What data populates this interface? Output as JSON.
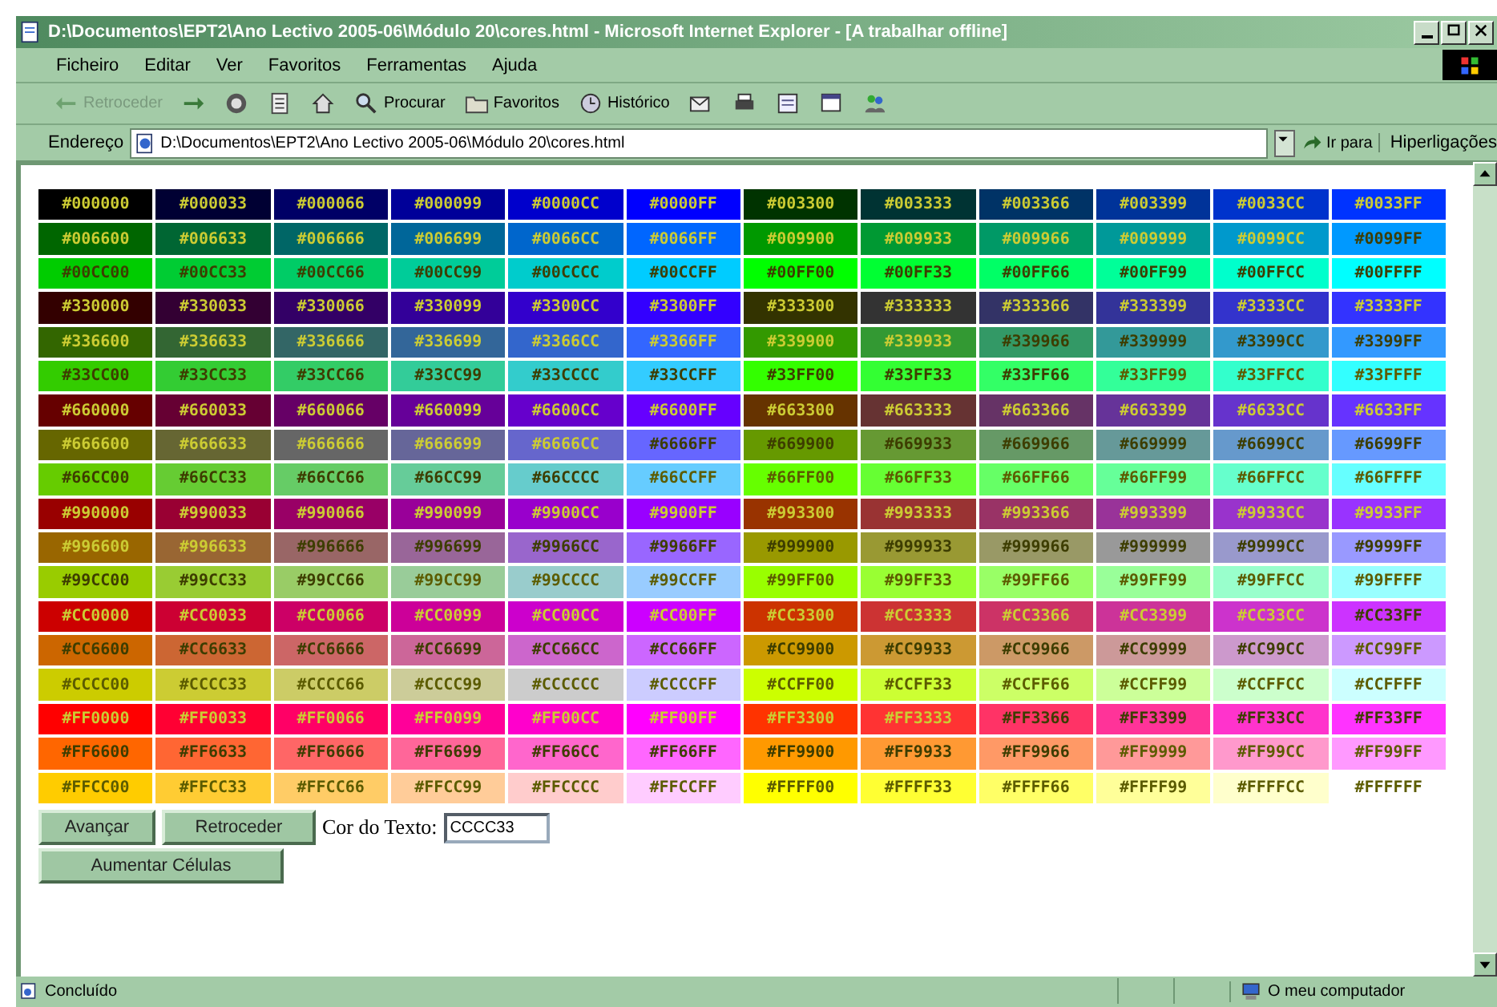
{
  "window": {
    "title": "D:\\Documentos\\EPT2\\Ano Lectivo 2005-06\\Módulo 20\\cores.html - Microsoft Internet Explorer - [A trabalhar offline]"
  },
  "menu": [
    "Ficheiro",
    "Editar",
    "Ver",
    "Favoritos",
    "Ferramentas",
    "Ajuda"
  ],
  "toolbar": [
    {
      "kind": "back",
      "label": "Retroceder",
      "disabled": true
    },
    {
      "kind": "forward"
    },
    {
      "kind": "stop"
    },
    {
      "kind": "refresh"
    },
    {
      "kind": "home"
    },
    {
      "kind": "search",
      "label": "Procurar"
    },
    {
      "kind": "favorites",
      "label": "Favoritos"
    },
    {
      "kind": "history",
      "label": "Histórico"
    },
    {
      "kind": "mail"
    },
    {
      "kind": "print"
    },
    {
      "kind": "edit"
    },
    {
      "kind": "discuss"
    },
    {
      "kind": "messenger"
    }
  ],
  "address": {
    "label": "Endereço",
    "value": "D:\\Documentos\\EPT2\\Ano Lectivo 2005-06\\Módulo 20\\cores.html",
    "go": "Ir para",
    "links": "Hiperligações"
  },
  "table": {
    "rows": [
      [
        {
          "text": "#000000",
          "color": "#000000"
        },
        {
          "text": "#000033",
          "color": "#000033"
        },
        {
          "text": "#000066",
          "color": "#000066"
        },
        {
          "text": "#000099",
          "color": "#000099"
        },
        {
          "text": "#0000CC",
          "color": "#0000cc"
        },
        {
          "text": "#0000FF",
          "color": "#0000ff"
        },
        {
          "text": "#003300",
          "color": "#003300"
        },
        {
          "text": "#003333",
          "color": "#003333"
        },
        {
          "text": "#003366",
          "color": "#003366"
        },
        {
          "text": "#003399",
          "color": "#003399"
        },
        {
          "text": "#0033CC",
          "color": "#0033cc"
        },
        {
          "text": "#0033FF",
          "color": "#0033ff"
        }
      ],
      [
        {
          "text": "#006600",
          "color": "#006600"
        },
        {
          "text": "#006633",
          "color": "#006633"
        },
        {
          "text": "#006666",
          "color": "#006666"
        },
        {
          "text": "#006699",
          "color": "#006699"
        },
        {
          "text": "#0066CC",
          "color": "#0066cc"
        },
        {
          "text": "#0066FF",
          "color": "#0066ff"
        },
        {
          "text": "#009900",
          "color": "#009900"
        },
        {
          "text": "#009933",
          "color": "#009933"
        },
        {
          "text": "#009966",
          "color": "#009966"
        },
        {
          "text": "#009999",
          "color": "#009999"
        },
        {
          "text": "#0099CC",
          "color": "#0099cc"
        },
        {
          "text": "#0099FF",
          "color": "#0099ff"
        }
      ],
      [
        {
          "text": "#00CC00",
          "color": "#00cc00"
        },
        {
          "text": "#00CC33",
          "color": "#00cc33"
        },
        {
          "text": "#00CC66",
          "color": "#00cc66"
        },
        {
          "text": "#00CC99",
          "color": "#00cc99"
        },
        {
          "text": "#00CCCC",
          "color": "#00cccc"
        },
        {
          "text": "#00CCFF",
          "color": "#00ccff"
        },
        {
          "text": "#00FF00",
          "color": "#00ff00"
        },
        {
          "text": "#00FF33",
          "color": "#00ff33"
        },
        {
          "text": "#00FF66",
          "color": "#00ff66"
        },
        {
          "text": "#00FF99",
          "color": "#00ff99"
        },
        {
          "text": "#00FFCC",
          "color": "#00ffcc"
        },
        {
          "text": "#00FFFF",
          "color": "#00ffff"
        }
      ],
      [
        {
          "text": "#330000",
          "color": "#330000"
        },
        {
          "text": "#330033",
          "color": "#330033"
        },
        {
          "text": "#330066",
          "color": "#330066"
        },
        {
          "text": "#330099",
          "color": "#330099"
        },
        {
          "text": "#3300CC",
          "color": "#3300cc"
        },
        {
          "text": "#3300FF",
          "color": "#3300ff"
        },
        {
          "text": "#333300",
          "color": "#333300"
        },
        {
          "text": "#333333",
          "color": "#333333"
        },
        {
          "text": "#333366",
          "color": "#333366"
        },
        {
          "text": "#333399",
          "color": "#333399"
        },
        {
          "text": "#3333CC",
          "color": "#3333cc"
        },
        {
          "text": "#3333FF",
          "color": "#3333ff"
        }
      ],
      [
        {
          "text": "#336600",
          "color": "#336600"
        },
        {
          "text": "#336633",
          "color": "#336633"
        },
        {
          "text": "#336666",
          "color": "#336666"
        },
        {
          "text": "#336699",
          "color": "#336699"
        },
        {
          "text": "#3366CC",
          "color": "#3366cc"
        },
        {
          "text": "#3366FF",
          "color": "#3366ff"
        },
        {
          "text": "#339900",
          "color": "#339900"
        },
        {
          "text": "#339933",
          "color": "#339933"
        },
        {
          "text": "#339966",
          "color": "#339966"
        },
        {
          "text": "#339999",
          "color": "#339999"
        },
        {
          "text": "#3399CC",
          "color": "#3399cc"
        },
        {
          "text": "#3399FF",
          "color": "#3399ff"
        }
      ],
      [
        {
          "text": "#33CC00",
          "color": "#33cc00"
        },
        {
          "text": "#33CC33",
          "color": "#33cc33"
        },
        {
          "text": "#33CC66",
          "color": "#33cc66"
        },
        {
          "text": "#33CC99",
          "color": "#33cc99"
        },
        {
          "text": "#33CCCC",
          "color": "#33cccc"
        },
        {
          "text": "#33CCFF",
          "color": "#33ccff"
        },
        {
          "text": "#33FF00",
          "color": "#33ff00"
        },
        {
          "text": "#33FF33",
          "color": "#33ff33"
        },
        {
          "text": "#33FF66",
          "color": "#33ff66"
        },
        {
          "text": "#33FF99",
          "color": "#33ff99"
        },
        {
          "text": "#33FFCC",
          "color": "#33ffcc"
        },
        {
          "text": "#33FFFF",
          "color": "#33ffff"
        }
      ],
      [
        {
          "text": "#660000",
          "color": "#660000"
        },
        {
          "text": "#660033",
          "color": "#660033"
        },
        {
          "text": "#660066",
          "color": "#660066"
        },
        {
          "text": "#660099",
          "color": "#660099"
        },
        {
          "text": "#6600CC",
          "color": "#6600cc"
        },
        {
          "text": "#6600FF",
          "color": "#6600ff"
        },
        {
          "text": "#663300",
          "color": "#663300"
        },
        {
          "text": "#663333",
          "color": "#663333"
        },
        {
          "text": "#663366",
          "color": "#663366"
        },
        {
          "text": "#663399",
          "color": "#663399"
        },
        {
          "text": "#6633CC",
          "color": "#6633cc"
        },
        {
          "text": "#6633FF",
          "color": "#6633ff"
        }
      ],
      [
        {
          "text": "#666600",
          "color": "#666600"
        },
        {
          "text": "#666633",
          "color": "#666633"
        },
        {
          "text": "#666666",
          "color": "#666666"
        },
        {
          "text": "#666699",
          "color": "#666699"
        },
        {
          "text": "#6666CC",
          "color": "#6666cc"
        },
        {
          "text": "#6666FF",
          "color": "#6666ff"
        },
        {
          "text": "#669900",
          "color": "#669900"
        },
        {
          "text": "#669933",
          "color": "#669933"
        },
        {
          "text": "#669966",
          "color": "#669966"
        },
        {
          "text": "#669999",
          "color": "#669999"
        },
        {
          "text": "#6699CC",
          "color": "#6699cc"
        },
        {
          "text": "#6699FF",
          "color": "#6699ff"
        }
      ],
      [
        {
          "text": "#66CC00",
          "color": "#66cc00"
        },
        {
          "text": "#66CC33",
          "color": "#66cc33"
        },
        {
          "text": "#66CC66",
          "color": "#66cc66"
        },
        {
          "text": "#66CC99",
          "color": "#66cc99"
        },
        {
          "text": "#66CCCC",
          "color": "#66cccc"
        },
        {
          "text": "#66CCFF",
          "color": "#66ccff"
        },
        {
          "text": "#66FF00",
          "color": "#66ff00"
        },
        {
          "text": "#66FF33",
          "color": "#66ff33"
        },
        {
          "text": "#66FF66",
          "color": "#66ff66"
        },
        {
          "text": "#66FF99",
          "color": "#66ff99"
        },
        {
          "text": "#66FFCC",
          "color": "#66ffcc"
        },
        {
          "text": "#66FFFF",
          "color": "#66ffff"
        }
      ],
      [
        {
          "text": "#990000",
          "color": "#990000"
        },
        {
          "text": "#990033",
          "color": "#990033"
        },
        {
          "text": "#990066",
          "color": "#990066"
        },
        {
          "text": "#990099",
          "color": "#990099"
        },
        {
          "text": "#9900CC",
          "color": "#9900cc"
        },
        {
          "text": "#9900FF",
          "color": "#9900ff"
        },
        {
          "text": "#993300",
          "color": "#993300"
        },
        {
          "text": "#993333",
          "color": "#993333"
        },
        {
          "text": "#993366",
          "color": "#993366"
        },
        {
          "text": "#993399",
          "color": "#993399"
        },
        {
          "text": "#9933CC",
          "color": "#9933cc"
        },
        {
          "text": "#9933FF",
          "color": "#9933ff"
        }
      ],
      [
        {
          "text": "#996600",
          "color": "#996600"
        },
        {
          "text": "#996633",
          "color": "#996633"
        },
        {
          "text": "#996666",
          "color": "#996666"
        },
        {
          "text": "#996699",
          "color": "#996699"
        },
        {
          "text": "#9966CC",
          "color": "#9966cc"
        },
        {
          "text": "#9966FF",
          "color": "#9966ff"
        },
        {
          "text": "#999900",
          "color": "#999900"
        },
        {
          "text": "#999933",
          "color": "#999933"
        },
        {
          "text": "#999966",
          "color": "#999966"
        },
        {
          "text": "#999999",
          "color": "#999999"
        },
        {
          "text": "#9999CC",
          "color": "#9999cc"
        },
        {
          "text": "#9999FF",
          "color": "#9999ff"
        }
      ],
      [
        {
          "text": "#99CC00",
          "color": "#99cc00"
        },
        {
          "text": "#99CC33",
          "color": "#99cc33"
        },
        {
          "text": "#99CC66",
          "color": "#99cc66"
        },
        {
          "text": "#99CC99",
          "color": "#99cc99"
        },
        {
          "text": "#99CCCC",
          "color": "#99cccc"
        },
        {
          "text": "#99CCFF",
          "color": "#99ccff"
        },
        {
          "text": "#99FF00",
          "color": "#99ff00"
        },
        {
          "text": "#99FF33",
          "color": "#99ff33"
        },
        {
          "text": "#99FF66",
          "color": "#99ff66"
        },
        {
          "text": "#99FF99",
          "color": "#99ff99"
        },
        {
          "text": "#99FFCC",
          "color": "#99ffcc"
        },
        {
          "text": "#99FFFF",
          "color": "#99ffff"
        }
      ],
      [
        {
          "text": "#CC0000",
          "color": "#cc0000"
        },
        {
          "text": "#CC0033",
          "color": "#cc0033"
        },
        {
          "text": "#CC0066",
          "color": "#cc0066"
        },
        {
          "text": "#CC0099",
          "color": "#cc0099"
        },
        {
          "text": "#CC00CC",
          "color": "#cc00cc"
        },
        {
          "text": "#CC00FF",
          "color": "#cc00ff"
        },
        {
          "text": "#CC3300",
          "color": "#cc3300"
        },
        {
          "text": "#CC3333",
          "color": "#cc3333"
        },
        {
          "text": "#CC3366",
          "color": "#cc3366"
        },
        {
          "text": "#CC3399",
          "color": "#cc3399"
        },
        {
          "text": "#CC33CC",
          "color": "#cc33cc"
        },
        {
          "text": "#CC33FF",
          "color": "#cc33ff"
        }
      ],
      [
        {
          "text": "#CC6600",
          "color": "#cc6600"
        },
        {
          "text": "#CC6633",
          "color": "#cc6633"
        },
        {
          "text": "#CC6666",
          "color": "#cc6666"
        },
        {
          "text": "#CC6699",
          "color": "#cc6699"
        },
        {
          "text": "#CC66CC",
          "color": "#cc66cc"
        },
        {
          "text": "#CC66FF",
          "color": "#cc66ff"
        },
        {
          "text": "#CC9900",
          "color": "#cc9900"
        },
        {
          "text": "#CC9933",
          "color": "#cc9933"
        },
        {
          "text": "#CC9966",
          "color": "#cc9966"
        },
        {
          "text": "#CC9999",
          "color": "#cc9999"
        },
        {
          "text": "#CC99CC",
          "color": "#cc99cc"
        },
        {
          "text": "#CC99FF",
          "color": "#cc99ff"
        }
      ],
      [
        {
          "text": "#CCCC00",
          "color": "#cccc00"
        },
        {
          "text": "#CCCC33",
          "color": "#cccc33"
        },
        {
          "text": "#CCCC66",
          "color": "#cccc66"
        },
        {
          "text": "#CCCC99",
          "color": "#cccc99"
        },
        {
          "text": "#CCCCCC",
          "color": "#cccccc"
        },
        {
          "text": "#CCCCFF",
          "color": "#ccccff"
        },
        {
          "text": "#CCFF00",
          "color": "#ccff00"
        },
        {
          "text": "#CCFF33",
          "color": "#ccff33"
        },
        {
          "text": "#CCFF66",
          "color": "#ccff66"
        },
        {
          "text": "#CCFF99",
          "color": "#ccff99"
        },
        {
          "text": "#CCFFCC",
          "color": "#ccffcc"
        },
        {
          "text": "#CCFFFF",
          "color": "#ccffff"
        }
      ],
      [
        {
          "text": "#FF0000",
          "color": "#ff0000"
        },
        {
          "text": "#FF0033",
          "color": "#ff0033"
        },
        {
          "text": "#FF0066",
          "color": "#ff0066"
        },
        {
          "text": "#FF0099",
          "color": "#ff0099"
        },
        {
          "text": "#FF00CC",
          "color": "#ff00cc"
        },
        {
          "text": "#FF00FF",
          "color": "#ff00ff"
        },
        {
          "text": "#FF3300",
          "color": "#ff3300"
        },
        {
          "text": "#FF3333",
          "color": "#ff3333"
        },
        {
          "text": "#FF3366",
          "color": "#ff3366"
        },
        {
          "text": "#FF3399",
          "color": "#ff3399"
        },
        {
          "text": "#FF33CC",
          "color": "#ff33cc"
        },
        {
          "text": "#FF33FF",
          "color": "#ff33ff"
        }
      ],
      [
        {
          "text": "#FF6600",
          "color": "#ff6600"
        },
        {
          "text": "#FF6633",
          "color": "#ff6633"
        },
        {
          "text": "#FF6666",
          "color": "#ff6666"
        },
        {
          "text": "#FF6699",
          "color": "#ff6699"
        },
        {
          "text": "#FF66CC",
          "color": "#ff66cc"
        },
        {
          "text": "#FF66FF",
          "color": "#ff66ff"
        },
        {
          "text": "#FF9900",
          "color": "#ff9900"
        },
        {
          "text": "#FF9933",
          "color": "#ff9933"
        },
        {
          "text": "#FF9966",
          "color": "#ff9966"
        },
        {
          "text": "#FF9999",
          "color": "#ff9999"
        },
        {
          "text": "#FF99CC",
          "color": "#ff99cc"
        },
        {
          "text": "#FF99FF",
          "color": "#ff99ff"
        }
      ],
      [
        {
          "text": "#FFCC00",
          "color": "#ffcc00"
        },
        {
          "text": "#FFCC33",
          "color": "#ffcc33"
        },
        {
          "text": "#FFCC66",
          "color": "#ffcc66"
        },
        {
          "text": "#FFCC99",
          "color": "#ffcc99"
        },
        {
          "text": "#FFCCCC",
          "color": "#ffcccc"
        },
        {
          "text": "#FFCCFF",
          "color": "#ffccff"
        },
        {
          "text": "#FFFF00",
          "color": "#ffff00"
        },
        {
          "text": "#FFFF33",
          "color": "#ffff33"
        },
        {
          "text": "#FFFF66",
          "color": "#ffff66"
        },
        {
          "text": "#FFFF99",
          "color": "#ffff99"
        },
        {
          "text": "#FFFFCC",
          "color": "#ffffcc"
        },
        {
          "text": "#FFFFFF",
          "color": "#ffffff"
        }
      ]
    ]
  },
  "controls": {
    "buttons": [
      "Avançar",
      "Retroceder"
    ],
    "text_color_label": "Cor do Texto:",
    "text_color_value": "CCCC33",
    "grow_button": "Aumentar Células"
  },
  "status_bar": {
    "text": "Concluído",
    "zone": "O meu computador"
  }
}
